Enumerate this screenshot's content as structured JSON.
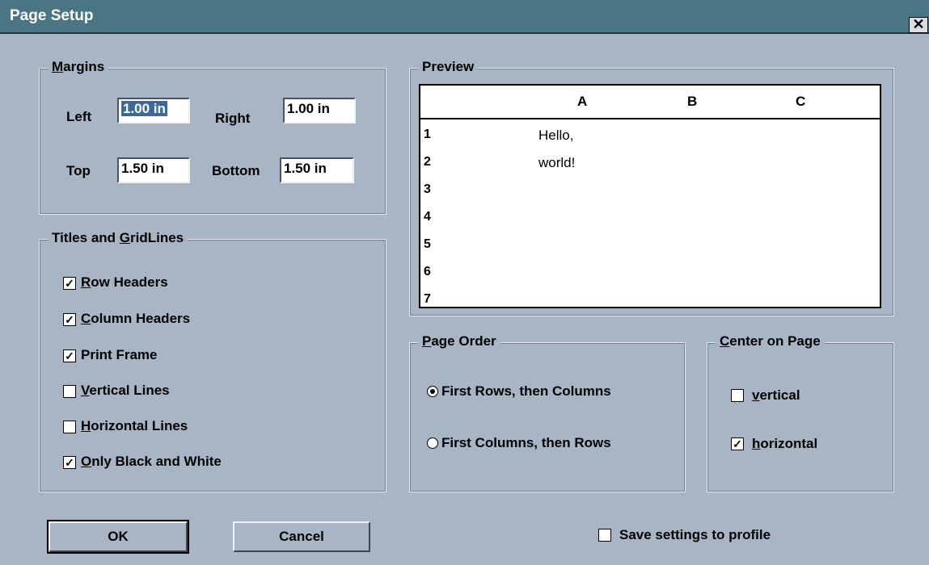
{
  "window": {
    "title": "Page Setup",
    "close_glyph": "✕"
  },
  "margins": {
    "legend_hot": "M",
    "legend_rest": "argins",
    "left_label": "Left",
    "left_value": "1.00 in",
    "right_label": "Right",
    "right_value": "1.00 in",
    "top_label": "Top",
    "top_value": "1.50 in",
    "bottom_label": "Bottom",
    "bottom_value": "1.50 in"
  },
  "titles_gridlines": {
    "legend_pre": "Titles and ",
    "legend_hot": "G",
    "legend_rest": "ridLines",
    "options": [
      {
        "hot": "R",
        "rest": "ow Headers",
        "checked": true
      },
      {
        "hot": "C",
        "rest": "olumn Headers",
        "checked": true
      },
      {
        "hot": "",
        "rest": "Print Frame",
        "checked": true
      },
      {
        "hot": "V",
        "rest": "ertical Lines",
        "checked": false
      },
      {
        "hot": "H",
        "rest": "orizontal Lines",
        "checked": false
      },
      {
        "hot": "O",
        "rest": "nly Black and White",
        "checked": true
      }
    ]
  },
  "preview": {
    "legend": "Preview",
    "columns": [
      "A",
      "B",
      "C"
    ],
    "rows": [
      "1",
      "2",
      "3",
      "4",
      "5",
      "6",
      "7"
    ],
    "cells": {
      "A1": "Hello,",
      "A2": "world!"
    }
  },
  "page_order": {
    "legend_hot": "P",
    "legend_rest": "age Order",
    "option1": "First Rows, then Columns",
    "option2": "First Columns, then Rows",
    "selected": 1
  },
  "center_on_page": {
    "legend_hot": "C",
    "legend_rest": "enter on Page",
    "vertical_hot": "v",
    "vertical_rest": "ertical",
    "vertical_checked": false,
    "horizontal_hot": "h",
    "horizontal_rest": "orizontal",
    "horizontal_checked": true
  },
  "buttons": {
    "ok": "OK",
    "cancel": "Cancel"
  },
  "save_settings": {
    "label": "Save settings to profile",
    "checked": false
  },
  "check_glyph": "✓"
}
